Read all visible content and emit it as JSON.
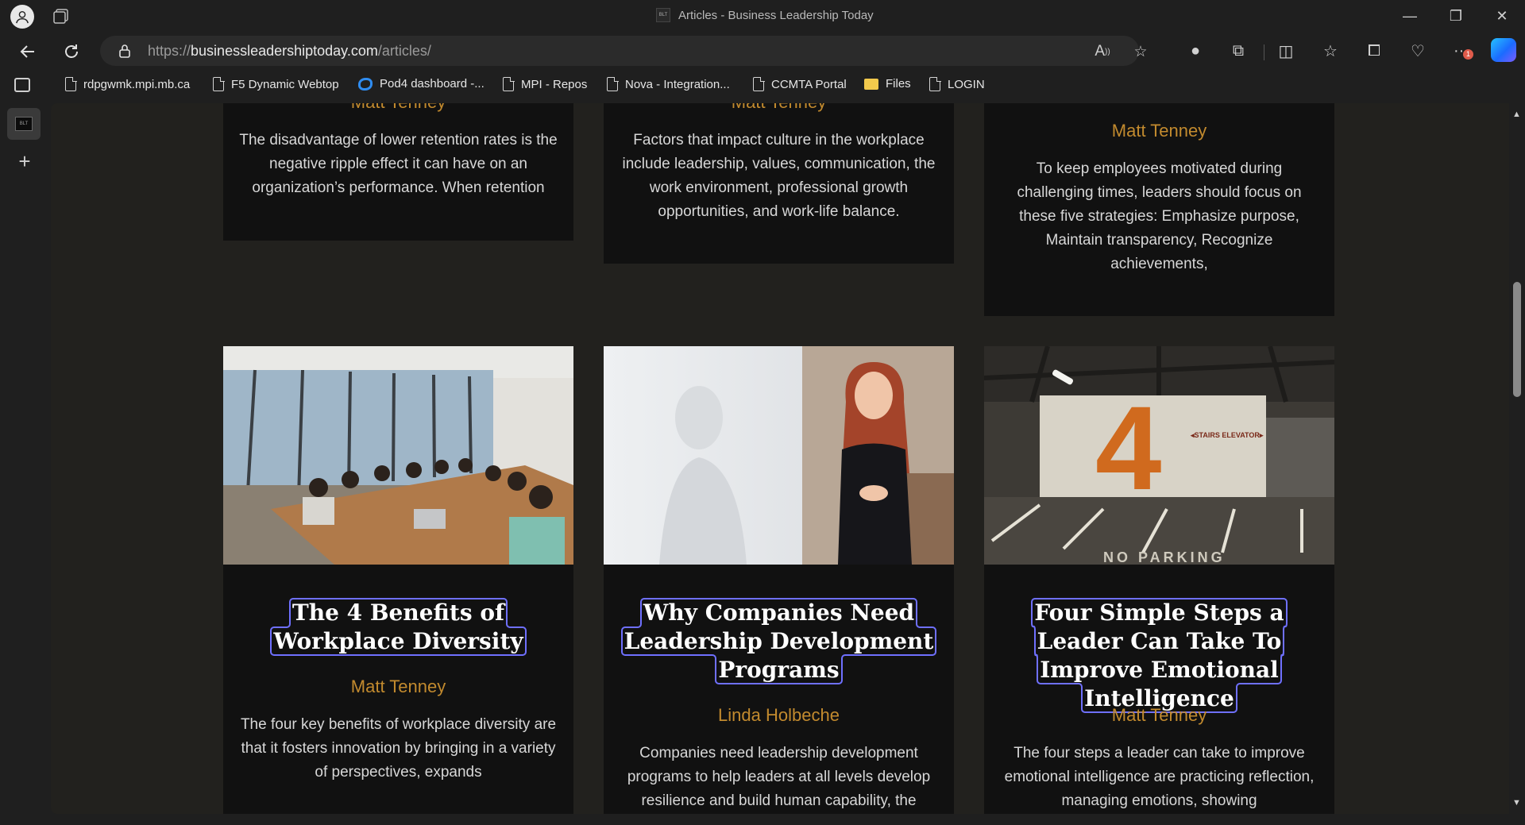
{
  "window": {
    "title": "Articles - Business Leadership Today",
    "favicon_text": "BLT",
    "controls": {
      "minimize": "—",
      "restore": "❐",
      "close": "✕"
    }
  },
  "nav": {
    "url_prefix": "https://",
    "url_domain": "businessleadershiptoday.com",
    "url_path": "/articles/",
    "notification_count": "1"
  },
  "bookmarks": [
    {
      "label": "rdpgwmk.mpi.mb.ca",
      "icon": "document-icon"
    },
    {
      "label": "F5 Dynamic Webtop",
      "icon": "document-icon"
    },
    {
      "label": "Pod4 dashboard -...",
      "icon": "azure-devops-icon"
    },
    {
      "label": "MPI - Repos",
      "icon": "document-icon"
    },
    {
      "label": "Nova - Integration...",
      "icon": "document-icon"
    },
    {
      "label": "CCMTA Portal",
      "icon": "document-icon"
    },
    {
      "label": "Files",
      "icon": "folder-icon"
    },
    {
      "label": "LOGIN",
      "icon": "document-icon"
    }
  ],
  "colors": {
    "page_bg": "#22211e",
    "card_bg": "#111111",
    "author": "#c28a2e",
    "focus_outline": "#6f70ff"
  },
  "top_cards": [
    {
      "author": "Matt Tenney",
      "excerpt": "The disadvantage of lower retention rates is the negative ripple effect it can have on an organization’s performance. When retention"
    },
    {
      "author": "Matt Tenney",
      "excerpt": "Factors that impact culture in the workplace include leadership, values, communication, the work environment, professional growth opportunities, and work-life balance."
    },
    {
      "author": "Matt Tenney",
      "excerpt": "To keep employees motivated during challenging times, leaders should focus on these five strategies: Emphasize purpose, Maintain transparency, Recognize achievements,"
    }
  ],
  "cards": [
    {
      "title": "The 4 Benefits of Workplace Diversity",
      "author": "Matt Tenney",
      "excerpt": "The four key benefits of workplace diversity are that it fosters innovation by bringing in a variety of perspectives, expands",
      "image": "conference-room-meeting-photo"
    },
    {
      "title": "Why Companies Need Leadership Development Programs",
      "author": "Linda Holbeche",
      "excerpt": "Companies need leadership development programs to help leaders at all levels develop resilience and build human capability, the",
      "image": "woman-at-whiteboard-photo"
    },
    {
      "title": "Four Simple Steps a Leader Can Take To Improve Emotional Intelligence",
      "author": "Matt Tenney",
      "excerpt": "The four steps a leader can take to improve emotional intelligence are practicing reflection, managing emotions, showing",
      "image": "parking-garage-photo",
      "image_text": {
        "number": "4",
        "sign": "◂STAIRS ELEVATOR▸",
        "floor": "NO PARKING"
      }
    }
  ]
}
